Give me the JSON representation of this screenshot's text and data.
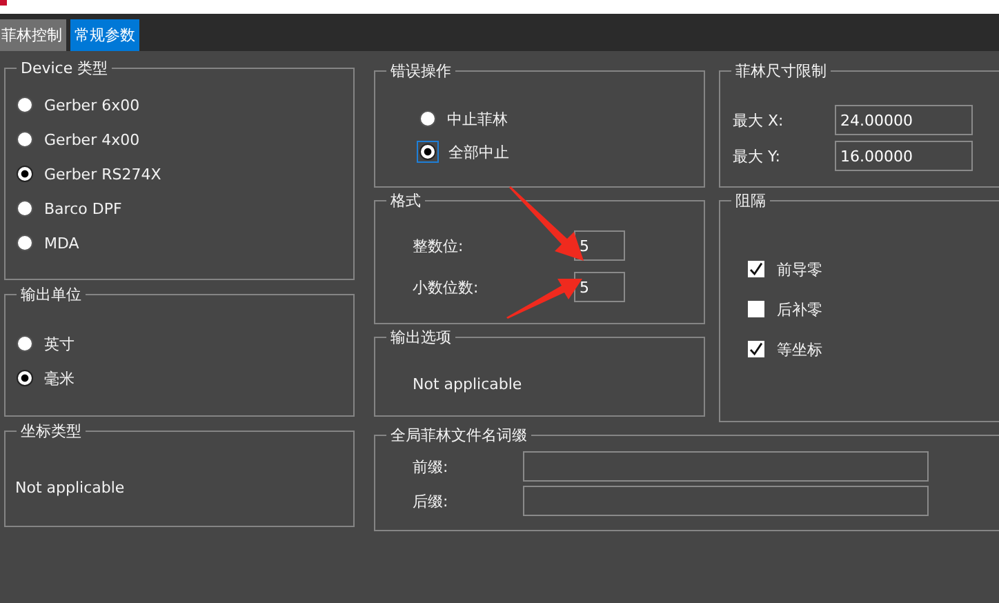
{
  "tabs": [
    {
      "label": "菲林控制",
      "selected": false
    },
    {
      "label": "常规参数",
      "selected": true
    }
  ],
  "device_type": {
    "title": "Device 类型",
    "options": [
      {
        "label": "Gerber 6x00",
        "selected": false
      },
      {
        "label": "Gerber 4x00",
        "selected": false
      },
      {
        "label": "Gerber RS274X",
        "selected": true
      },
      {
        "label": "Barco DPF",
        "selected": false
      },
      {
        "label": "MDA",
        "selected": false
      }
    ]
  },
  "output_unit": {
    "title": "输出单位",
    "options": [
      {
        "label": "英寸",
        "selected": false
      },
      {
        "label": "毫米",
        "selected": true
      }
    ]
  },
  "coordinate_type": {
    "title": "坐标类型",
    "text": "Not applicable"
  },
  "error_action": {
    "title": "错误操作",
    "options": [
      {
        "label": "中止菲林",
        "selected": false,
        "focused": false
      },
      {
        "label": "全部中止",
        "selected": true,
        "focused": true
      }
    ]
  },
  "format": {
    "title": "格式",
    "fields": [
      {
        "label": "整数位:",
        "value": "5"
      },
      {
        "label": "小数位数:",
        "value": "5"
      }
    ]
  },
  "output_options": {
    "title": "输出选项",
    "text": "Not applicable"
  },
  "film_size_limit": {
    "title": "菲林尺寸限制",
    "fields": [
      {
        "label": "最大 X:",
        "value": "24.00000"
      },
      {
        "label": "最大 Y:",
        "value": "16.00000"
      }
    ]
  },
  "zero_suppression": {
    "title": "阻隔",
    "options": [
      {
        "label": "前导零",
        "checked": true
      },
      {
        "label": "后补零",
        "checked": false
      },
      {
        "label": "等坐标",
        "checked": true
      }
    ]
  },
  "global_film_affix": {
    "title": "全局菲林文件名词缀",
    "fields": [
      {
        "label": "前缀:"
      },
      {
        "label": "后缀:"
      }
    ]
  }
}
